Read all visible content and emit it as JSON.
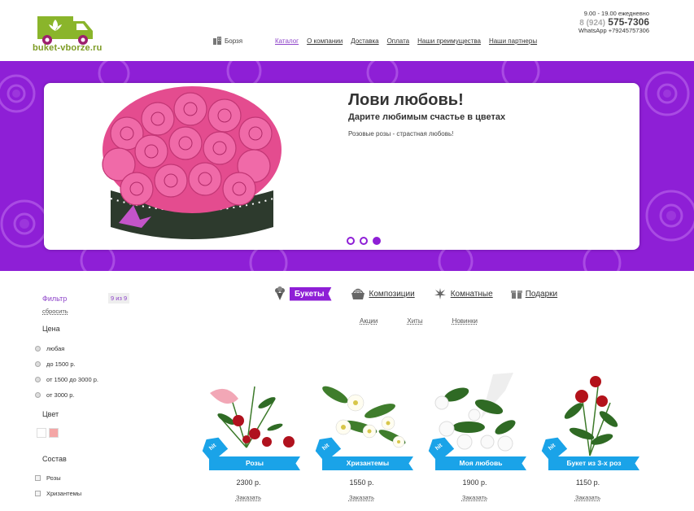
{
  "header": {
    "logo_text": "buket-vborze.ru",
    "city": "Борзя",
    "nav": [
      "Каталог",
      "О компании",
      "Доставка",
      "Оплата",
      "Наши преимущества",
      "Наши партнеры"
    ],
    "hours": "9.00 - 19.00 ежедневно",
    "phone_code": "8 (924)",
    "phone_number": "575-7306",
    "whatsapp": "WhatsApp +79245757306"
  },
  "banner": {
    "title": "Лови любовь!",
    "subtitle": "Дарите любимым счастье в цветах",
    "description": "Розовые розы - страстная любовь!",
    "slides_total": 3,
    "active_slide": 3
  },
  "filter": {
    "title": "Фильтр",
    "reset": "сбросить",
    "count": "9 из 9",
    "price_title": "Цена",
    "price_options": [
      "любая",
      "до 1500 р.",
      "от 1500 до 3000 р.",
      "от 3000 р."
    ],
    "color_title": "Цвет",
    "colors": [
      "#ffffff",
      "#f4a6a6"
    ],
    "composition_title": "Состав",
    "composition_options": [
      "Розы",
      "Хризантемы"
    ]
  },
  "categories": [
    {
      "label": "Букеты",
      "icon": "bouquet-icon",
      "active": true
    },
    {
      "label": "Композиции",
      "icon": "basket-icon",
      "active": false
    },
    {
      "label": "Комнатные",
      "icon": "plant-icon",
      "active": false
    },
    {
      "label": "Подарки",
      "icon": "gift-icon",
      "active": false
    }
  ],
  "subcategories": [
    "Акции",
    "Хиты",
    "Новинки"
  ],
  "products": [
    {
      "name": "Розы",
      "price": "2300 р.",
      "badge": "hit",
      "order": "Заказать"
    },
    {
      "name": "Хризантемы",
      "price": "1550 р.",
      "badge": "hit",
      "order": "Заказать"
    },
    {
      "name": "Моя любовь",
      "price": "1900 р.",
      "badge": "hit",
      "order": "Заказать"
    },
    {
      "name": "Букет из 3-х роз",
      "price": "1150 р.",
      "badge": "hit",
      "order": "Заказать"
    }
  ],
  "colors": {
    "accent": "#8e1fd6",
    "ribbon": "#1aa3e8",
    "logo_green": "#7d9b24"
  }
}
